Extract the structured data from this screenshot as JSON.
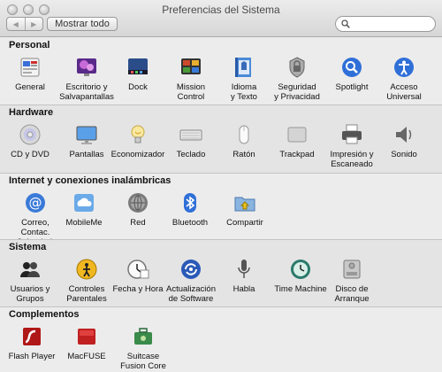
{
  "window": {
    "title": "Preferencias del Sistema"
  },
  "toolbar": {
    "back": "◀",
    "forward": "▶",
    "show_all": "Mostrar todo",
    "search_placeholder": ""
  },
  "sections": [
    {
      "title": "Personal",
      "items": [
        {
          "label": "General",
          "icon": "general-icon"
        },
        {
          "label": "Escritorio y\nSalvapantallas",
          "icon": "desktop-icon"
        },
        {
          "label": "Dock",
          "icon": "dock-icon"
        },
        {
          "label": "Mission\nControl",
          "icon": "mission-control-icon"
        },
        {
          "label": "Idioma\ny Texto",
          "icon": "language-icon"
        },
        {
          "label": "Seguridad\ny Privacidad",
          "icon": "security-icon"
        },
        {
          "label": "Spotlight",
          "icon": "spotlight-icon"
        },
        {
          "label": "Acceso\nUniversal",
          "icon": "accessibility-icon"
        }
      ]
    },
    {
      "title": "Hardware",
      "items": [
        {
          "label": "CD y DVD",
          "icon": "cd-icon"
        },
        {
          "label": "Pantallas",
          "icon": "display-icon"
        },
        {
          "label": "Economizador",
          "icon": "bulb-icon"
        },
        {
          "label": "Teclado",
          "icon": "keyboard-icon"
        },
        {
          "label": "Ratón",
          "icon": "mouse-icon"
        },
        {
          "label": "Trackpad",
          "icon": "trackpad-icon"
        },
        {
          "label": "Impresión y\nEscaneado",
          "icon": "printer-icon"
        },
        {
          "label": "Sonido",
          "icon": "speaker-icon"
        }
      ]
    },
    {
      "title": "Internet y conexiones inalámbricas",
      "items": [
        {
          "label": "Correo, Contac.\ny Calendarios",
          "icon": "mail-icon"
        },
        {
          "label": "MobileMe",
          "icon": "cloud-icon"
        },
        {
          "label": "Red",
          "icon": "network-icon"
        },
        {
          "label": "Bluetooth",
          "icon": "bluetooth-icon"
        },
        {
          "label": "Compartir",
          "icon": "sharing-icon"
        }
      ]
    },
    {
      "title": "Sistema",
      "items": [
        {
          "label": "Usuarios y\nGrupos",
          "icon": "users-icon"
        },
        {
          "label": "Controles\nParentales",
          "icon": "parental-icon"
        },
        {
          "label": "Fecha y Hora",
          "icon": "clock-icon"
        },
        {
          "label": "Actualización\nde Software",
          "icon": "update-icon"
        },
        {
          "label": "Habla",
          "icon": "microphone-icon"
        },
        {
          "label": "Time Machine",
          "icon": "time-machine-icon"
        },
        {
          "label": "Disco de\nArranque",
          "icon": "disk-icon"
        }
      ]
    },
    {
      "title": "Complementos",
      "items": [
        {
          "label": "Flash Player",
          "icon": "flash-icon"
        },
        {
          "label": "MacFUSE",
          "icon": "macfuse-icon"
        },
        {
          "label": "Suitcase\nFusion Core",
          "icon": "suitcase-icon"
        }
      ]
    }
  ]
}
